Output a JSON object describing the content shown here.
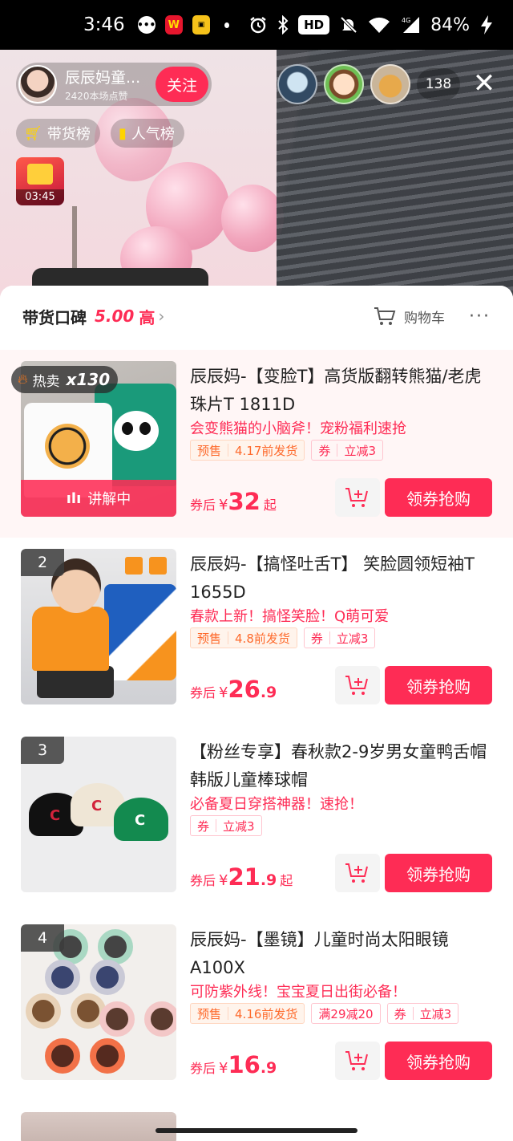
{
  "status_bar": {
    "time": "3:46",
    "hd_label": "HD",
    "network": "4G",
    "battery": "84%"
  },
  "live": {
    "anchor_name": "辰辰妈童...",
    "anchor_likes": "2420本场点赞",
    "follow_label": "关注",
    "viewer_count": "138",
    "rank_sales": "带货榜",
    "rank_popularity": "人气榜",
    "redpacket_timer": "03:45"
  },
  "sheet": {
    "reputation_label": "带货口碑",
    "reputation_score": "5.00",
    "reputation_level": "高",
    "cart_label": "购物车"
  },
  "products": [
    {
      "index": "",
      "hot_label": "热卖",
      "hot_count": "x130",
      "explaining_label": "讲解中",
      "title": "辰辰妈-【变脸T】高货版翻转熊猫/老虎珠片T 1811D",
      "subtitle": "会变熊猫的小脑斧！宠粉福利速抢",
      "tags": [
        {
          "key": "预售",
          "value": "4.17前发货",
          "kind": "pre"
        },
        {
          "key": "券",
          "value": "立减3",
          "kind": "coupon"
        }
      ],
      "price_prefix": "券后",
      "currency": "¥",
      "price_int": "32",
      "price_dec": "",
      "price_suffix": "起",
      "buy_label": "领券抢购"
    },
    {
      "index": "2",
      "title": "辰辰妈-【搞怪吐舌T】 笑脸圆领短袖T 1655D",
      "subtitle": "春款上新！搞怪笑脸！Q萌可爱",
      "tags": [
        {
          "key": "预售",
          "value": "4.8前发货",
          "kind": "pre"
        },
        {
          "key": "券",
          "value": "立减3",
          "kind": "coupon"
        }
      ],
      "price_prefix": "券后",
      "currency": "¥",
      "price_int": "26",
      "price_dec": ".9",
      "price_suffix": "",
      "buy_label": "领券抢购"
    },
    {
      "index": "3",
      "title": "【粉丝专享】春秋款2-9岁男女童鸭舌帽韩版儿童棒球帽",
      "subtitle": "必备夏日穿搭神器！速抢！",
      "tags": [
        {
          "key": "券",
          "value": "立减3",
          "kind": "coupon"
        }
      ],
      "price_prefix": "券后",
      "currency": "¥",
      "price_int": "21",
      "price_dec": ".9",
      "price_suffix": "起",
      "buy_label": "领券抢购"
    },
    {
      "index": "4",
      "title": "辰辰妈-【墨镜】儿童时尚太阳眼镜A100X",
      "subtitle": "可防紫外线！宝宝夏日出街必备！",
      "tags": [
        {
          "key": "预售",
          "value": "4.16前发货",
          "kind": "pre"
        },
        {
          "key": "满29减20",
          "value": "",
          "kind": "single"
        },
        {
          "key": "券",
          "value": "立减3",
          "kind": "coupon"
        }
      ],
      "price_prefix": "券后",
      "currency": "¥",
      "price_int": "16",
      "price_dec": ".9",
      "price_suffix": "",
      "buy_label": "领券抢购"
    }
  ]
}
